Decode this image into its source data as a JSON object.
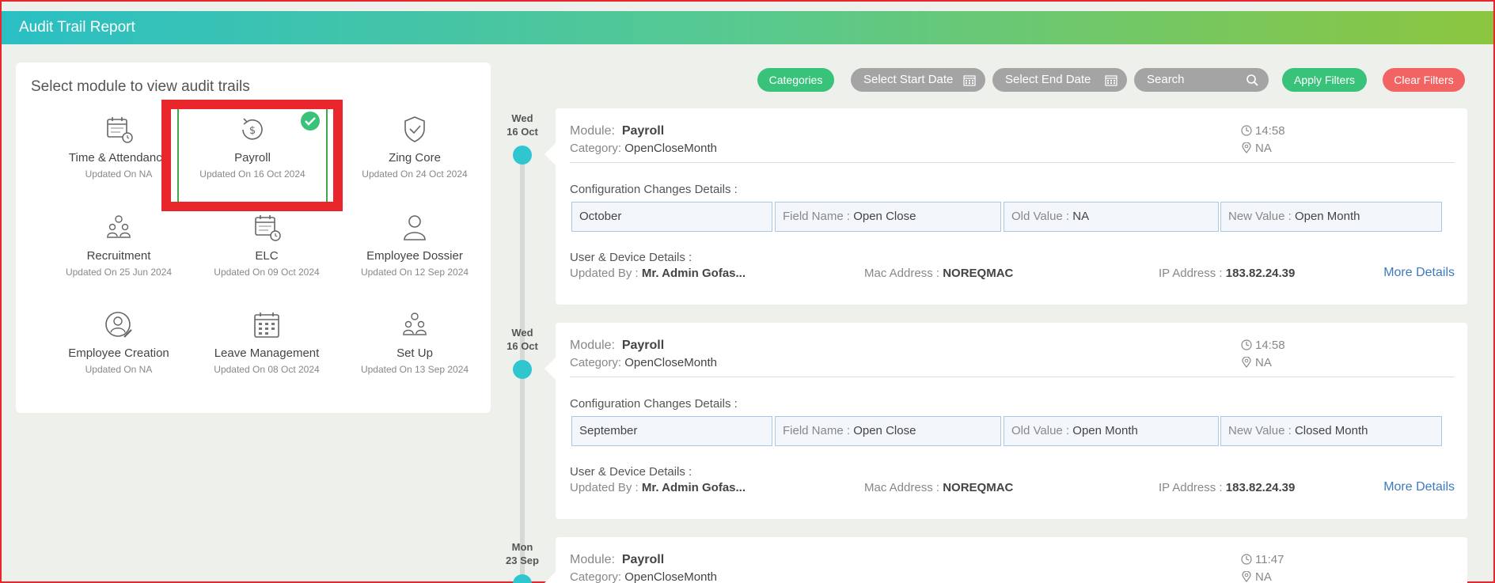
{
  "header": {
    "title": "Audit Trail Report"
  },
  "module_panel": {
    "heading": "Select module to view audit trails",
    "modules": [
      {
        "name": "Time & Attendance",
        "updated": "Updated On NA",
        "icon": "calendar-clock-icon",
        "selected": false
      },
      {
        "name": "Payroll",
        "updated": "Updated On 16 Oct 2024",
        "icon": "dollar-refresh-icon",
        "selected": true
      },
      {
        "name": "Zing Core",
        "updated": "Updated On 24 Oct 2024",
        "icon": "shield-check-icon",
        "selected": false
      },
      {
        "name": "Recruitment",
        "updated": "Updated On 25 Jun 2024",
        "icon": "people-meeting-icon",
        "selected": false
      },
      {
        "name": "ELC",
        "updated": "Updated On 09 Oct 2024",
        "icon": "calendar-clock-icon",
        "selected": false
      },
      {
        "name": "Employee Dossier",
        "updated": "Updated On 12 Sep 2024",
        "icon": "person-icon",
        "selected": false
      },
      {
        "name": "Employee Creation",
        "updated": "Updated On NA",
        "icon": "person-edit-icon",
        "selected": false
      },
      {
        "name": "Leave Management",
        "updated": "Updated On 08 Oct 2024",
        "icon": "calendar-grid-icon",
        "selected": false
      },
      {
        "name": "Set Up",
        "updated": "Updated On 13 Sep 2024",
        "icon": "people-meeting-icon",
        "selected": false
      }
    ]
  },
  "filters": {
    "categories": "Categories",
    "start_date": "Select Start Date",
    "end_date": "Select End Date",
    "search_placeholder": "Search",
    "apply": "Apply Filters",
    "clear": "Clear Filters"
  },
  "entries": [
    {
      "day": "Wed",
      "date": "16 Oct",
      "module_label": "Module:",
      "module": "Payroll",
      "category_label": "Category:",
      "category": "OpenCloseMonth",
      "time": "14:58",
      "location": "NA",
      "config_title": "Configuration Changes Details :",
      "config": {
        "item": "October",
        "field_label": "Field Name :",
        "field": "Open Close",
        "old_label": "Old Value :",
        "old": "NA",
        "new_label": "New Value :",
        "new": "Open Month"
      },
      "ud_title": "User & Device Details :",
      "updated_by_label": "Updated By :",
      "updated_by": "Mr. Admin Gofas...",
      "mac_label": "Mac Address :",
      "mac": "NOREQMAC",
      "ip_label": "IP Address :",
      "ip": "183.82.24.39",
      "more": "More Details"
    },
    {
      "day": "Wed",
      "date": "16 Oct",
      "module_label": "Module:",
      "module": "Payroll",
      "category_label": "Category:",
      "category": "OpenCloseMonth",
      "time": "14:58",
      "location": "NA",
      "config_title": "Configuration Changes Details :",
      "config": {
        "item": "September",
        "field_label": "Field Name :",
        "field": "Open Close",
        "old_label": "Old Value :",
        "old": "Open Month",
        "new_label": "New Value :",
        "new": "Closed Month"
      },
      "ud_title": "User & Device Details :",
      "updated_by_label": "Updated By :",
      "updated_by": "Mr. Admin Gofas...",
      "mac_label": "Mac Address :",
      "mac": "NOREQMAC",
      "ip_label": "IP Address :",
      "ip": "183.82.24.39",
      "more": "More Details"
    },
    {
      "day": "Mon",
      "date": "23 Sep",
      "module_label": "Module:",
      "module": "Payroll",
      "category_label": "Category:",
      "category": "OpenCloseMonth",
      "time": "11:47",
      "location": "NA"
    }
  ],
  "colors": {
    "accent_green": "#39c27a",
    "accent_teal": "#2fc6cf",
    "clear_red": "#f26464",
    "link_blue": "#3c7bbf"
  }
}
